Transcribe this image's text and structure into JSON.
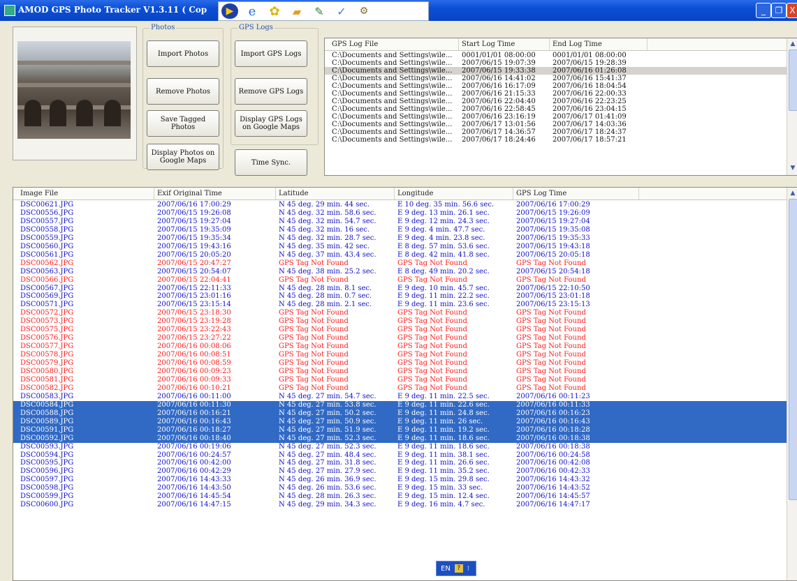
{
  "window": {
    "title": "AMOD GPS Photo Tracker V1.3.11  ( Cop",
    "buttons": [
      "_",
      "❐",
      "X"
    ]
  },
  "toolbar": {
    "icons": [
      "media-player-icon",
      "ie-icon",
      "yellow-flower-icon",
      "book-icon",
      "pen-icon",
      "notepad-icon",
      "tools-icon"
    ]
  },
  "photos_group": {
    "label": "Photos",
    "buttons": [
      "Import Photos",
      "Remove Photos",
      "Save Tagged Photos",
      "Display Photos on Google Maps"
    ]
  },
  "gps_group": {
    "label": "GPS Logs",
    "buttons": [
      "Import GPS Logs",
      "Remove GPS Logs",
      "Display GPS Logs on Google Maps",
      "Time Sync."
    ]
  },
  "gps_table": {
    "headers": [
      "GPS Log File",
      "Start Log Time",
      "End Log Time"
    ],
    "rows": [
      [
        "C:\\Documents and Settings\\wile...",
        "0001/01/01 08:00:00",
        "0001/01/01 08:00:00"
      ],
      [
        "C:\\Documents and Settings\\wile...",
        "2007/06/15 19:07:39",
        "2007/06/15 19:28:39"
      ],
      [
        "C:\\Documents and Settings\\wile...",
        "2007/06/15 19:33:38",
        "2007/06/16 01:26:08"
      ],
      [
        "C:\\Documents and Settings\\wile...",
        "2007/06/16 14:41:02",
        "2007/06/16 15:41:37"
      ],
      [
        "C:\\Documents and Settings\\wile...",
        "2007/06/16 16:17:09",
        "2007/06/16 18:04:54"
      ],
      [
        "C:\\Documents and Settings\\wile...",
        "2007/06/16 21:15:33",
        "2007/06/16 22:00:33"
      ],
      [
        "C:\\Documents and Settings\\wile...",
        "2007/06/16 22:04:40",
        "2007/06/16 22:23:25"
      ],
      [
        "C:\\Documents and Settings\\wile...",
        "2007/06/16 22:58:45",
        "2007/06/16 23:04:15"
      ],
      [
        "C:\\Documents and Settings\\wile...",
        "2007/06/16 23:16:19",
        "2007/06/17 01:41:09"
      ],
      [
        "C:\\Documents and Settings\\wile...",
        "2007/06/17 13:01:56",
        "2007/06/17 14:03:36"
      ],
      [
        "C:\\Documents and Settings\\wile...",
        "2007/06/17 14:36:57",
        "2007/06/17 18:24:37"
      ],
      [
        "C:\\Documents and Settings\\wile...",
        "2007/06/17 18:24:46",
        "2007/06/17 18:57:21"
      ]
    ],
    "highlighted_row": 2
  },
  "image_table": {
    "headers": [
      "Image File",
      "Exif Original Time",
      "Latitude",
      "Longitude",
      "GPS Log Time"
    ],
    "rows": [
      {
        "f": "DSC00621.JPG",
        "t": "2007/06/16 17:00:29",
        "lat": "N 45 deg. 29 min. 44 sec.",
        "lon": "E 10 deg. 35 min. 56.6 sec.",
        "g": "2007/06/16 17:00:29",
        "s": "ok"
      },
      {
        "f": "DSC00556.JPG",
        "t": "2007/06/15 19:26:08",
        "lat": "N 45 deg. 32 min. 58.6 sec.",
        "lon": "E 9 deg. 13 min. 26.1 sec.",
        "g": "2007/06/15 19:26:09",
        "s": "ok"
      },
      {
        "f": "DSC00557.JPG",
        "t": "2007/06/15 19:27:04",
        "lat": "N 45 deg. 32 min. 54.7 sec.",
        "lon": "E 9 deg. 12 min. 24.3 sec.",
        "g": "2007/06/15 19:27:04",
        "s": "ok"
      },
      {
        "f": "DSC00558.JPG",
        "t": "2007/06/15 19:35:09",
        "lat": "N 45 deg. 32 min. 16 sec.",
        "lon": "E 9 deg. 4 min. 47.7 sec.",
        "g": "2007/06/15 19:35:08",
        "s": "ok"
      },
      {
        "f": "DSC00559.JPG",
        "t": "2007/06/15 19:35:34",
        "lat": "N 45 deg. 32 min. 28.7 sec.",
        "lon": "E 9 deg. 4 min. 23.8 sec.",
        "g": "2007/06/15 19:35:33",
        "s": "ok"
      },
      {
        "f": "DSC00560.JPG",
        "t": "2007/06/15 19:43:16",
        "lat": "N 45 deg. 35 min. 42 sec.",
        "lon": "E 8 deg. 57 min. 53.6 sec.",
        "g": "2007/06/15 19:43:18",
        "s": "ok"
      },
      {
        "f": "DSC00561.JPG",
        "t": "2007/06/15 20:05:20",
        "lat": "N 45 deg. 37 min. 43.4 sec.",
        "lon": "E 8 deg. 42 min. 41.8 sec.",
        "g": "2007/06/15 20:05:18",
        "s": "ok"
      },
      {
        "f": "DSC00562.JPG",
        "t": "2007/06/15 20:47:27",
        "lat": "GPS Tag Not Found",
        "lon": "GPS Tag Not Found",
        "g": "GPS Tag Not Found",
        "s": "err"
      },
      {
        "f": "DSC00563.JPG",
        "t": "2007/06/15 20:54:07",
        "lat": "N 45 deg. 38 min. 25.2 sec.",
        "lon": "E 8 deg. 49 min. 20.2 sec.",
        "g": "2007/06/15 20:54:18",
        "s": "ok"
      },
      {
        "f": "DSC00566.JPG",
        "t": "2007/06/15 22:04:41",
        "lat": "GPS Tag Not Found",
        "lon": "GPS Tag Not Found",
        "g": "GPS Tag Not Found",
        "s": "err"
      },
      {
        "f": "DSC00567.JPG",
        "t": "2007/06/15 22:11:33",
        "lat": "N 45 deg. 28 min. 8.1 sec.",
        "lon": "E 9 deg. 10 min. 45.7 sec.",
        "g": "2007/06/15 22:10:50",
        "s": "ok"
      },
      {
        "f": "DSC00569.JPG",
        "t": "2007/06/15 23:01:16",
        "lat": "N 45 deg. 28 min. 0.7 sec.",
        "lon": "E 9 deg. 11 min. 22.2 sec.",
        "g": "2007/06/15 23:01:18",
        "s": "ok"
      },
      {
        "f": "DSC00571.JPG",
        "t": "2007/06/15 23:15:14",
        "lat": "N 45 deg. 28 min. 2.1 sec.",
        "lon": "E 9 deg. 11 min. 23.6 sec.",
        "g": "2007/06/15 23:15:13",
        "s": "ok"
      },
      {
        "f": "DSC00572.JPG",
        "t": "2007/06/15 23:18:30",
        "lat": "GPS Tag Not Found",
        "lon": "GPS Tag Not Found",
        "g": "GPS Tag Not Found",
        "s": "err"
      },
      {
        "f": "DSC00573.JPG",
        "t": "2007/06/15 23:19:28",
        "lat": "GPS Tag Not Found",
        "lon": "GPS Tag Not Found",
        "g": "GPS Tag Not Found",
        "s": "err"
      },
      {
        "f": "DSC00575.JPG",
        "t": "2007/06/15 23:22:43",
        "lat": "GPS Tag Not Found",
        "lon": "GPS Tag Not Found",
        "g": "GPS Tag Not Found",
        "s": "err"
      },
      {
        "f": "DSC00576.JPG",
        "t": "2007/06/15 23:27:22",
        "lat": "GPS Tag Not Found",
        "lon": "GPS Tag Not Found",
        "g": "GPS Tag Not Found",
        "s": "err"
      },
      {
        "f": "DSC00577.JPG",
        "t": "2007/06/16 00:08:06",
        "lat": "GPS Tag Not Found",
        "lon": "GPS Tag Not Found",
        "g": "GPS Tag Not Found",
        "s": "err"
      },
      {
        "f": "DSC00578.JPG",
        "t": "2007/06/16 00:08:51",
        "lat": "GPS Tag Not Found",
        "lon": "GPS Tag Not Found",
        "g": "GPS Tag Not Found",
        "s": "err"
      },
      {
        "f": "DSC00579.JPG",
        "t": "2007/06/16 00:08:59",
        "lat": "GPS Tag Not Found",
        "lon": "GPS Tag Not Found",
        "g": "GPS Tag Not Found",
        "s": "err"
      },
      {
        "f": "DSC00580.JPG",
        "t": "2007/06/16 00:09:23",
        "lat": "GPS Tag Not Found",
        "lon": "GPS Tag Not Found",
        "g": "GPS Tag Not Found",
        "s": "err"
      },
      {
        "f": "DSC00581.JPG",
        "t": "2007/06/16 00:09:33",
        "lat": "GPS Tag Not Found",
        "lon": "GPS Tag Not Found",
        "g": "GPS Tag Not Found",
        "s": "err"
      },
      {
        "f": "DSC00582.JPG",
        "t": "2007/06/16 00:10:21",
        "lat": "GPS Tag Not Found",
        "lon": "GPS Tag Not Found",
        "g": "GPS Tag Not Found",
        "s": "err"
      },
      {
        "f": "DSC00583.JPG",
        "t": "2007/06/16 00:11:00",
        "lat": "N 45 deg. 27 min. 54.7 sec.",
        "lon": "E 9 deg. 11 min. 22.5 sec.",
        "g": "2007/06/16 00:11:23",
        "s": "ok"
      },
      {
        "f": "DSC00584.JPG",
        "t": "2007/06/16 00:11:30",
        "lat": "N 45 deg. 27 min. 53.8 sec.",
        "lon": "E 9 deg. 11 min. 22.6 sec.",
        "g": "2007/06/16 00:11:33",
        "s": "sel"
      },
      {
        "f": "DSC00588.JPG",
        "t": "2007/06/16 00:16:21",
        "lat": "N 45 deg. 27 min. 50.2 sec.",
        "lon": "E 9 deg. 11 min. 24.8 sec.",
        "g": "2007/06/16 00:16:23",
        "s": "sel"
      },
      {
        "f": "DSC00589.JPG",
        "t": "2007/06/16 00:16:43",
        "lat": "N 45 deg. 27 min. 50.9 sec.",
        "lon": "E 9 deg. 11 min. 26 sec.",
        "g": "2007/06/16 00:16:43",
        "s": "sel"
      },
      {
        "f": "DSC00591.JPG",
        "t": "2007/06/16 00:18:27",
        "lat": "N 45 deg. 27 min. 51.9 sec.",
        "lon": "E 9 deg. 11 min. 19.2 sec.",
        "g": "2007/06/16 00:18:28",
        "s": "sel"
      },
      {
        "f": "DSC00592.JPG",
        "t": "2007/06/16 00:18:40",
        "lat": "N 45 deg. 27 min. 52.3 sec.",
        "lon": "E 9 deg. 11 min. 18.6 sec.",
        "g": "2007/06/16 00:18:38",
        "s": "sel"
      },
      {
        "f": "DSC00593.JPG",
        "t": "2007/06/16 00:19:06",
        "lat": "N 45 deg. 27 min. 52.3 sec.",
        "lon": "E 9 deg. 11 min. 18.6 sec.",
        "g": "2007/06/16 00:18:38",
        "s": "ok"
      },
      {
        "f": "DSC00594.JPG",
        "t": "2007/06/16 00:24:57",
        "lat": "N 45 deg. 27 min. 48.4 sec.",
        "lon": "E 9 deg. 11 min. 38.1 sec.",
        "g": "2007/06/16 00:24:58",
        "s": "ok"
      },
      {
        "f": "DSC00595.JPG",
        "t": "2007/06/16 00:42:00",
        "lat": "N 45 deg. 27 min. 31.8 sec.",
        "lon": "E 9 deg. 11 min. 26.6 sec.",
        "g": "2007/06/16 00:42:08",
        "s": "ok"
      },
      {
        "f": "DSC00596.JPG",
        "t": "2007/06/16 00:42:29",
        "lat": "N 45 deg. 27 min. 27.9 sec.",
        "lon": "E 9 deg. 11 min. 35.2 sec.",
        "g": "2007/06/16 00:42:33",
        "s": "ok"
      },
      {
        "f": "DSC00597.JPG",
        "t": "2007/06/16 14:43:33",
        "lat": "N 45 deg. 26 min. 36.9 sec.",
        "lon": "E 9 deg. 15 min. 29.8 sec.",
        "g": "2007/06/16 14:43:32",
        "s": "ok"
      },
      {
        "f": "DSC00598.JPG",
        "t": "2007/06/16 14:43:50",
        "lat": "N 45 deg. 26 min. 53.6 sec.",
        "lon": "E 9 deg. 15 min. 33 sec.",
        "g": "2007/06/16 14:43:52",
        "s": "ok"
      },
      {
        "f": "DSC00599.JPG",
        "t": "2007/06/16 14:45:54",
        "lat": "N 45 deg. 28 min. 26.3 sec.",
        "lon": "E 9 deg. 15 min. 12.4 sec.",
        "g": "2007/06/16 14:45:57",
        "s": "ok"
      },
      {
        "f": "DSC00600.JPG",
        "t": "2007/06/16 14:47:15",
        "lat": "N 45 deg. 29 min. 34.3 sec.",
        "lon": "E 9 deg. 16 min. 4.7 sec.",
        "g": "2007/06/16 14:47:17",
        "s": "ok"
      }
    ]
  },
  "ime": {
    "lang": "EN"
  },
  "colors": {
    "ok": "#1010c8",
    "err": "#ff1a1a",
    "selected_bg": "#316ac5",
    "selected_fg": "#ffffff"
  }
}
